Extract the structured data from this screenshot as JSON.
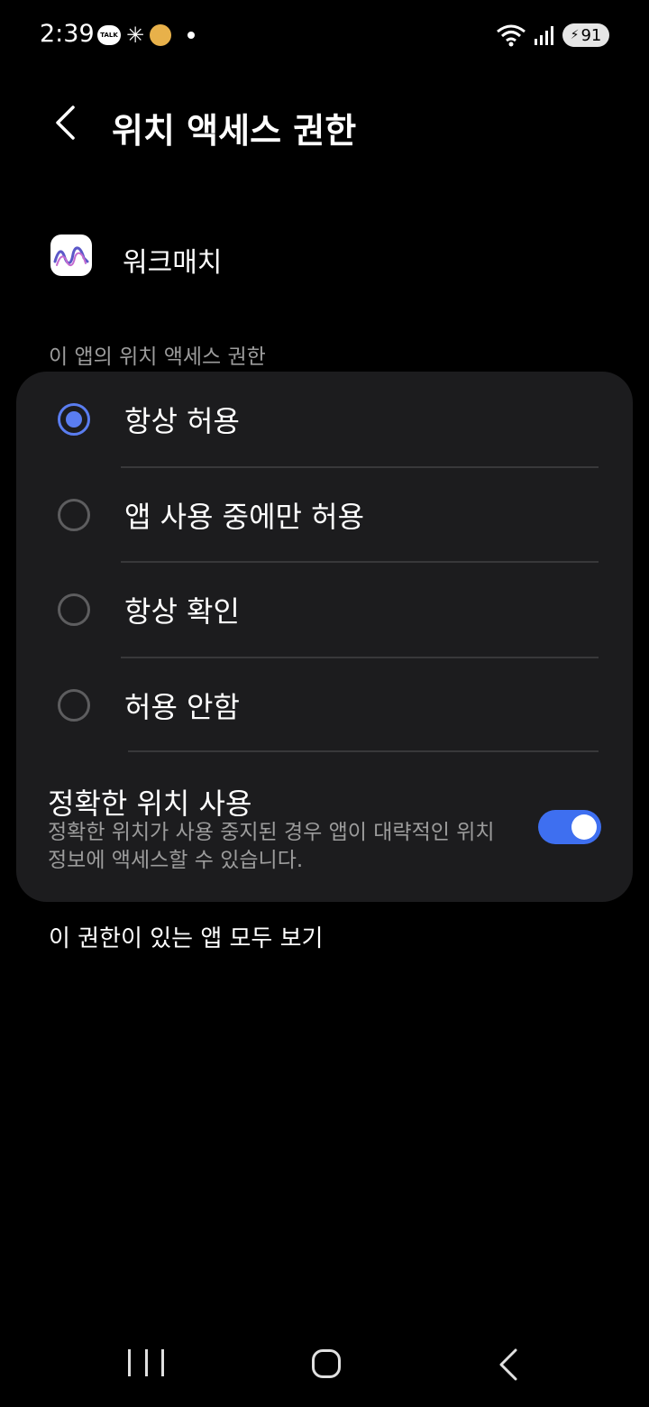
{
  "status_bar": {
    "time": "2:39",
    "talk_badge": "TALK",
    "battery_level": "91"
  },
  "header": {
    "title": "위치 액세스 권한"
  },
  "app": {
    "name": "워크매치"
  },
  "section_label": "이 앱의 위치 액세스 권한",
  "options": [
    {
      "label": "항상 허용",
      "selected": true
    },
    {
      "label": "앱 사용 중에만 허용",
      "selected": false
    },
    {
      "label": "항상 확인",
      "selected": false
    },
    {
      "label": "허용 안함",
      "selected": false
    }
  ],
  "precise_location": {
    "title": "정확한 위치 사용",
    "description": "정확한 위치가 사용 중지된 경우 앱이 대략적인 위치 정보에 액세스할 수 있습니다.",
    "enabled": true
  },
  "see_all_link": "이 권한이 있는 앱 모두 보기",
  "colors": {
    "accent": "#3e6ff0",
    "radio_selected": "#5a7df0",
    "card_bg": "#1c1c1e",
    "secondary_text": "#9c9c9c"
  }
}
